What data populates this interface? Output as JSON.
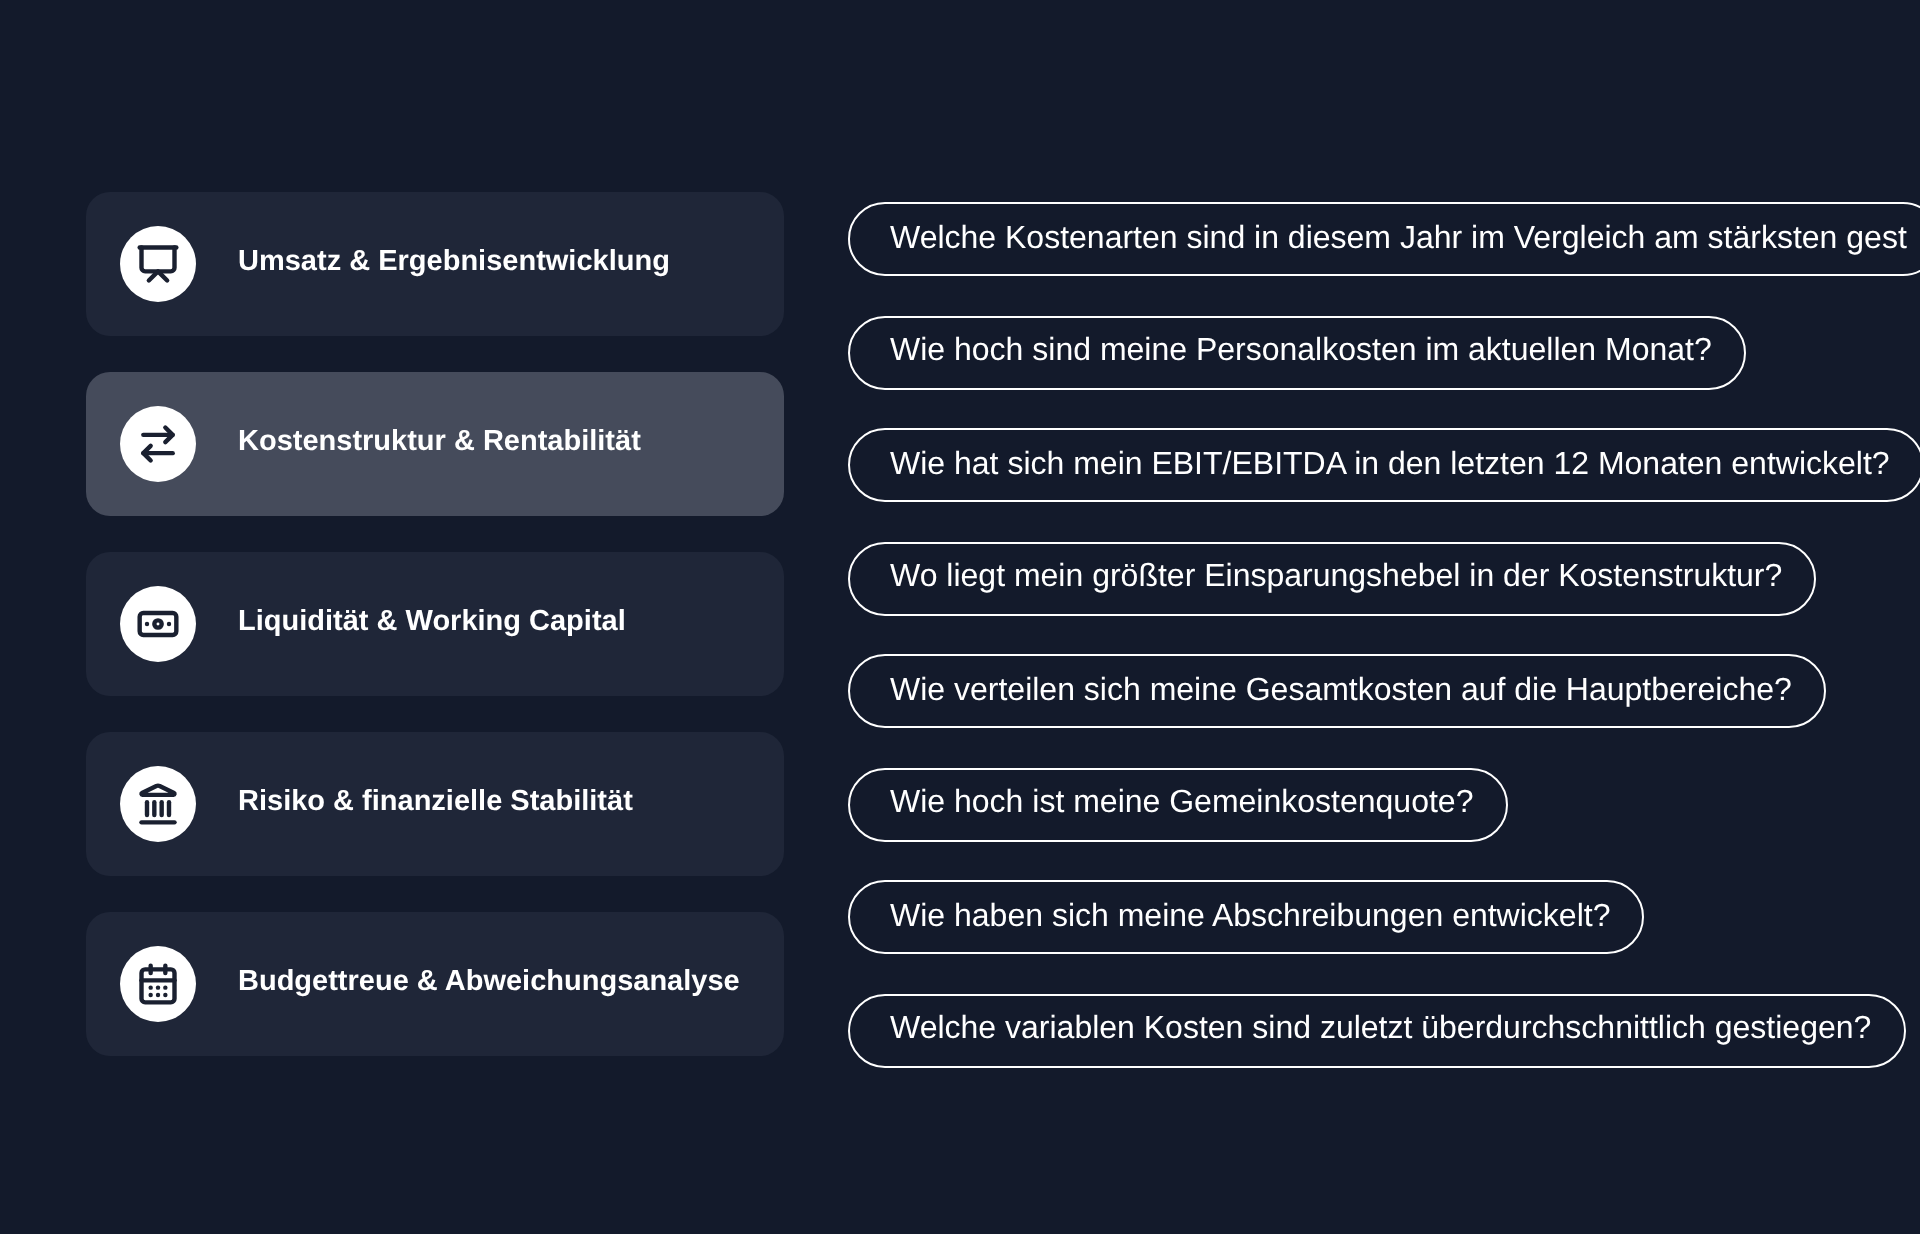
{
  "categories": [
    {
      "label": "Umsatz & Ergebnisentwicklung",
      "selected": false
    },
    {
      "label": "Kostenstruktur & Rentabilität",
      "selected": true
    },
    {
      "label": "Liquidität & Working Capital",
      "selected": false
    },
    {
      "label": "Risiko & finanzielle Stabilität",
      "selected": false
    },
    {
      "label": "Budgettreue & Abweichungsanalyse",
      "selected": false
    }
  ],
  "questions": [
    {
      "text": "Welche Kostenarten sind in diesem Jahr im Vergleich am stärksten gest"
    },
    {
      "text": "Wie hoch sind meine Personalkosten im aktuellen Monat?"
    },
    {
      "text": "Wie hat sich mein EBIT/EBITDA in den letzten 12 Monaten entwickelt?"
    },
    {
      "text": "Wo liegt mein größter Einsparungshebel in der Kostenstruktur?"
    },
    {
      "text": "Wie verteilen sich meine Gesamtkosten auf die Hauptbereiche?"
    },
    {
      "text": "Wie hoch ist meine Gemeinkostenquote?"
    },
    {
      "text": "Wie haben sich meine Abschreibungen entwickelt?"
    },
    {
      "text": "Welche variablen Kosten sind zuletzt überdurchschnittlich gestiegen?"
    }
  ]
}
